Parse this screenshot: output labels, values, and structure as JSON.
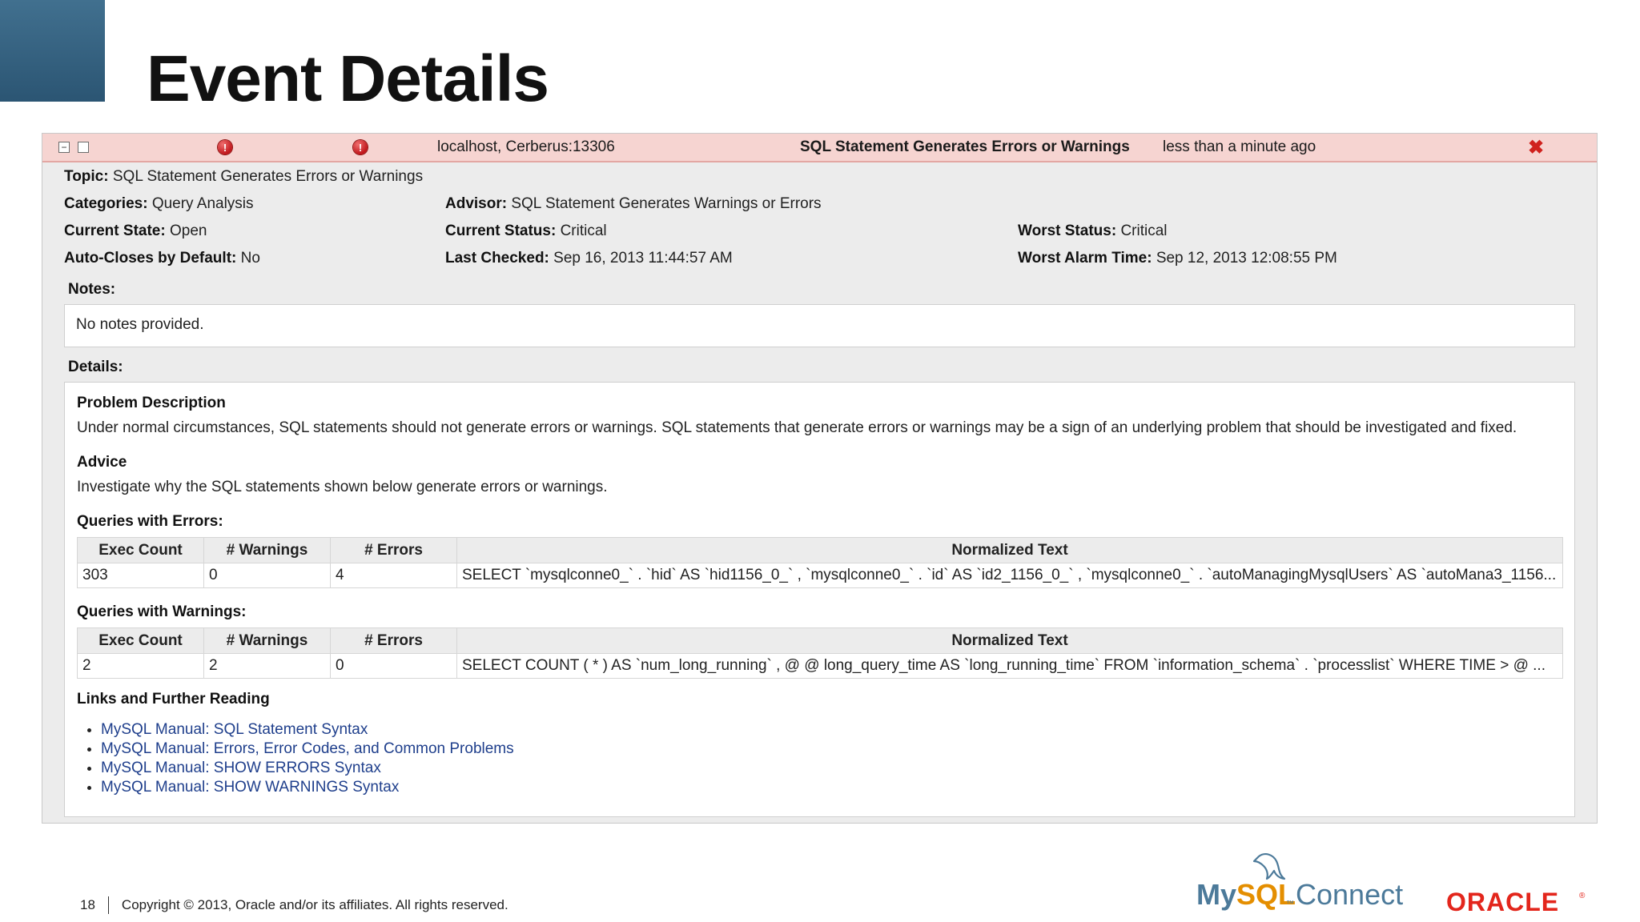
{
  "slide": {
    "title": "Event Details"
  },
  "event_header": {
    "host": "localhost, Cerberus:13306",
    "title": "SQL Statement Generates Errors or Warnings",
    "time": "less than a minute ago",
    "collapse_symbol": "−",
    "error_symbol": "!",
    "close_symbol": "✖"
  },
  "fields": {
    "topic": {
      "label": "Topic:",
      "value": "SQL Statement Generates Errors or Warnings"
    },
    "categories": {
      "label": "Categories:",
      "value": "Query Analysis"
    },
    "advisor": {
      "label": "Advisor:",
      "value": "SQL Statement Generates Warnings or Errors"
    },
    "current_state": {
      "label": "Current State:",
      "value": "Open"
    },
    "current_status": {
      "label": "Current Status:",
      "value": "Critical"
    },
    "worst_status": {
      "label": "Worst Status:",
      "value": "Critical"
    },
    "auto_closes": {
      "label": "Auto-Closes by Default:",
      "value": "No"
    },
    "last_checked": {
      "label": "Last Checked:",
      "value": "Sep 16, 2013 11:44:57 AM"
    },
    "worst_alarm_time": {
      "label": "Worst Alarm Time:",
      "value": "Sep 12, 2013 12:08:55 PM"
    }
  },
  "notes": {
    "label": "Notes:",
    "text": "No notes provided."
  },
  "details": {
    "label": "Details:",
    "problem_heading": "Problem Description",
    "problem_text": "Under normal circumstances, SQL statements should not generate errors or warnings. SQL statements that generate errors or warnings may be a sign of an underlying problem that should be investigated and fixed.",
    "advice_heading": "Advice",
    "advice_text": "Investigate why the SQL statements shown below generate errors or warnings.",
    "columns": [
      "Exec Count",
      "# Warnings",
      "# Errors",
      "Normalized Text"
    ],
    "errors_heading": "Queries with Errors:",
    "errors_row": {
      "exec_count": "303",
      "warnings": "0",
      "errors": "4",
      "text": "SELECT `mysqlconne0_` . `hid` AS `hid1156_0_` , `mysqlconne0_` . `id` AS `id2_1156_0_` , `mysqlconne0_` . `autoManagingMysqlUsers` AS `autoMana3_1156..."
    },
    "warnings_heading": "Queries with Warnings:",
    "warnings_row": {
      "exec_count": "2",
      "warnings": "2",
      "errors": "0",
      "text": "SELECT COUNT ( * ) AS `num_long_running` , @ @ long_query_time AS `long_running_time` FROM `information_schema` . `processlist` WHERE TIME > @ ..."
    },
    "links_heading": "Links and Further Reading",
    "links": [
      "MySQL Manual: SQL Statement Syntax",
      "MySQL Manual: Errors, Error Codes, and Common Problems",
      "MySQL Manual: SHOW ERRORS Syntax",
      "MySQL Manual: SHOW WARNINGS Syntax"
    ]
  },
  "footer": {
    "page_number": "18",
    "copyright": "Copyright © 2013, Oracle and/or its affiliates. All rights reserved."
  },
  "logos": {
    "mysql_text_1": "My",
    "mysql_text_2": "SQL",
    "mysql_tm": "™",
    "mysql_text_3": "Connect",
    "oracle_text": "ORACLE",
    "oracle_reg": "®"
  },
  "colors": {
    "header_bg": "#f6d4d1",
    "panel_bg": "#ececec",
    "link": "#1f3f8c",
    "error_red": "#c0161b",
    "oracle_red": "#e3261c",
    "mysql_blue": "#4c7a9a",
    "mysql_orange": "#e48e00"
  }
}
